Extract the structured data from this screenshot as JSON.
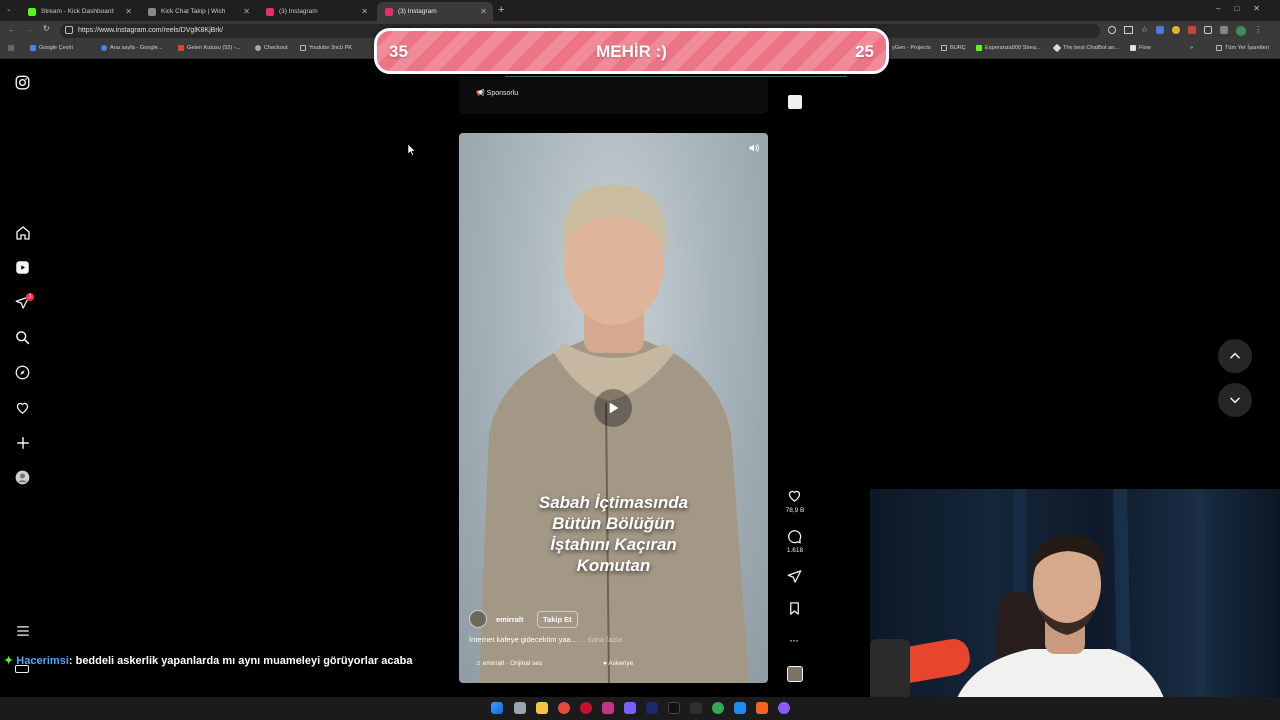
{
  "browser": {
    "tabs": [
      {
        "title": "Stream - Kick Dashboard",
        "color": "#53fc18"
      },
      {
        "title": "Kick Chat Takip | Wich",
        "color": "#cccccc"
      },
      {
        "title": "(3) Instagram",
        "color": "#e1306c"
      },
      {
        "title": "(3) Instagram",
        "color": "#e1306c"
      }
    ],
    "url": "https://www.instagram.com/reels/DVglK8KjBrk/",
    "bookmarks_left": [
      "Google Çeviri",
      "Ana sayfa - Google...",
      "Gelen Kutusu (52) -...",
      "Checkout",
      "Youtube 3ncü PK"
    ],
    "bookmarks_right": [
      "yGen - Projects",
      "BURÇ",
      "Esperanza000 Strea...",
      "The best ChatBot an...",
      "Flow"
    ],
    "bookmarks_all": "Tüm Yer İşaretleri"
  },
  "counter": {
    "left": "35",
    "center": "MEHİR :)",
    "right": "25"
  },
  "reel": {
    "sponsored": "Sponsorlu",
    "caption": [
      "Sabah İçtimasında",
      "Bütün Bölüğün",
      "İştahını Kaçıran",
      "Komutan"
    ],
    "username": "emirralt",
    "follow": "Takip Et",
    "description": "İnternet kafeye gidecektim yaa...",
    "more": "... daha fazla",
    "audio": "emirralt · Orijinal ses",
    "location": "Askeriye",
    "likes": "78,9 B",
    "comments": "1.618"
  },
  "sidebar": {
    "notification_count": "3"
  },
  "chat": {
    "nick": "Hacerimsi",
    "message": ": beddeli askerlik yapanlarda mı aynı muameleyi görüyorlar acaba"
  }
}
